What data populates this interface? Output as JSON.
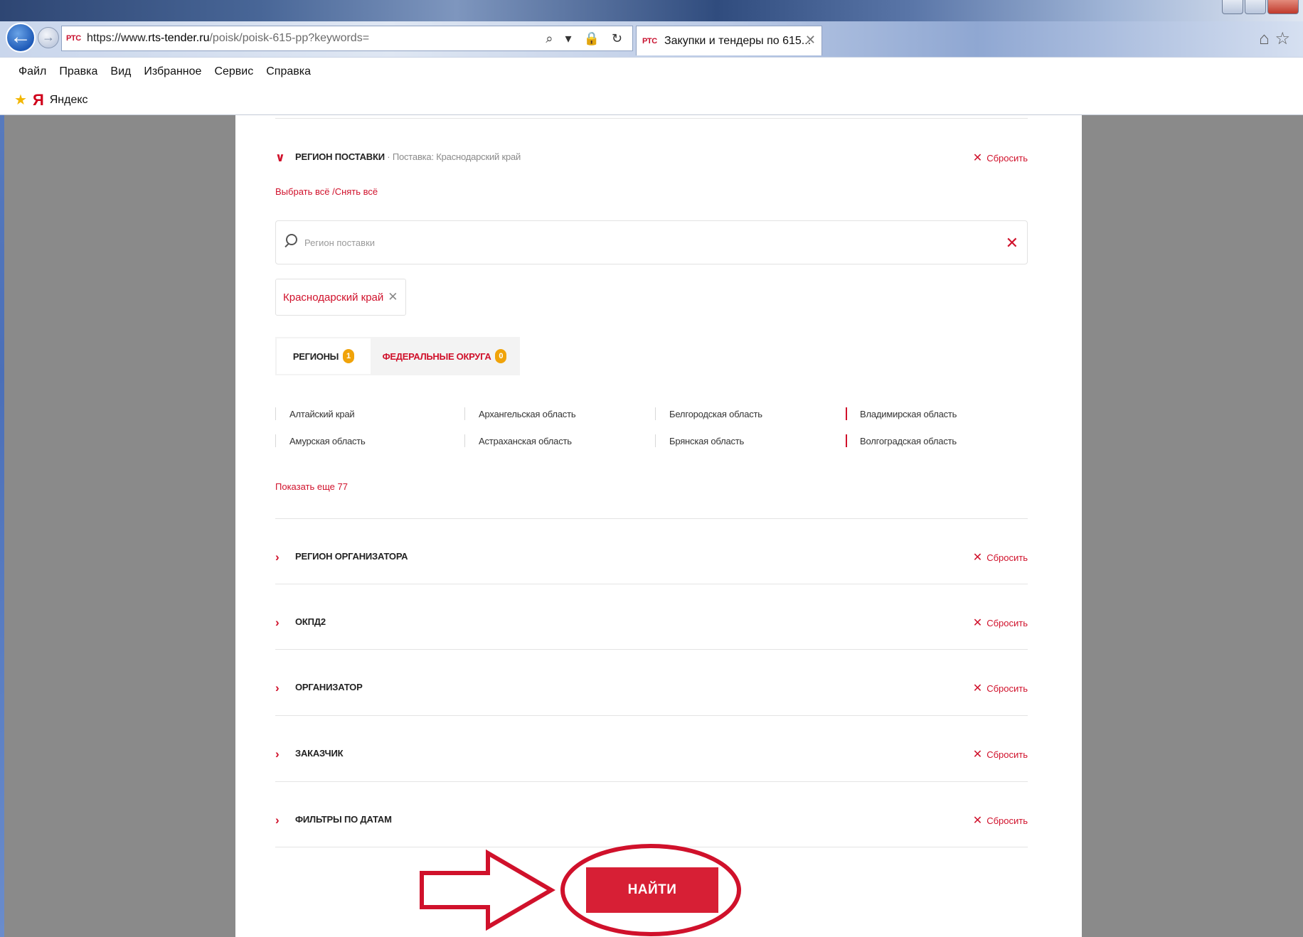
{
  "browser": {
    "url_prefix": "https://www.",
    "url_domain": "rts-tender.ru",
    "url_path": "/poisk/poisk-615-pp?keywords=",
    "favicon_text": "РТС",
    "address_icons": "⌕ ▾ 🔒 ↻",
    "tab_title": "Закупки и тендеры по 615...",
    "tab_close": "✕",
    "topright_icons": "⌂☆",
    "menu": [
      "Файл",
      "Правка",
      "Вид",
      "Избранное",
      "Сервис",
      "Справка"
    ],
    "favorites": {
      "site": "Яндекс",
      "logo": "Я"
    }
  },
  "filters": {
    "delivery_region": {
      "title": "РЕГИОН ПОСТАВКИ",
      "subtitle": " · Поставка: Краснодарский край",
      "reset_label": "Сбросить",
      "select_all": "Выбрать всё /Снять всё",
      "search_placeholder": "Регион поставки",
      "selected_chip": "Краснодарский край",
      "tabs": [
        {
          "label": "РЕГИОНЫ",
          "count": "1"
        },
        {
          "label": "ФЕДЕРАЛЬНЫЕ ОКРУГА",
          "count": "0"
        }
      ],
      "regions": [
        "Алтайский край",
        "Архангельская область",
        "Белгородская область",
        "Владимирская область",
        "Амурская область",
        "Астраханская область",
        "Брянская область",
        "Волгоградская область"
      ],
      "show_more": "Показать еще 77"
    },
    "collapsed_sections": [
      {
        "title": "РЕГИОН ОРГАНИЗАТОРА",
        "reset_label": "Сбросить"
      },
      {
        "title": "ОКПД2",
        "reset_label": "Сбросить"
      },
      {
        "title": "ОРГАНИЗАТОР",
        "reset_label": "Сбросить"
      },
      {
        "title": "ЗАКАЗЧИК",
        "reset_label": "Сбросить"
      },
      {
        "title": "ФИЛЬТРЫ ПО ДАТАМ",
        "reset_label": "Сбросить"
      }
    ],
    "submit_label": "НАЙТИ"
  },
  "colors": {
    "accent": "#d0112b",
    "badge": "#f0a30a",
    "annotation": "#d0112b"
  }
}
